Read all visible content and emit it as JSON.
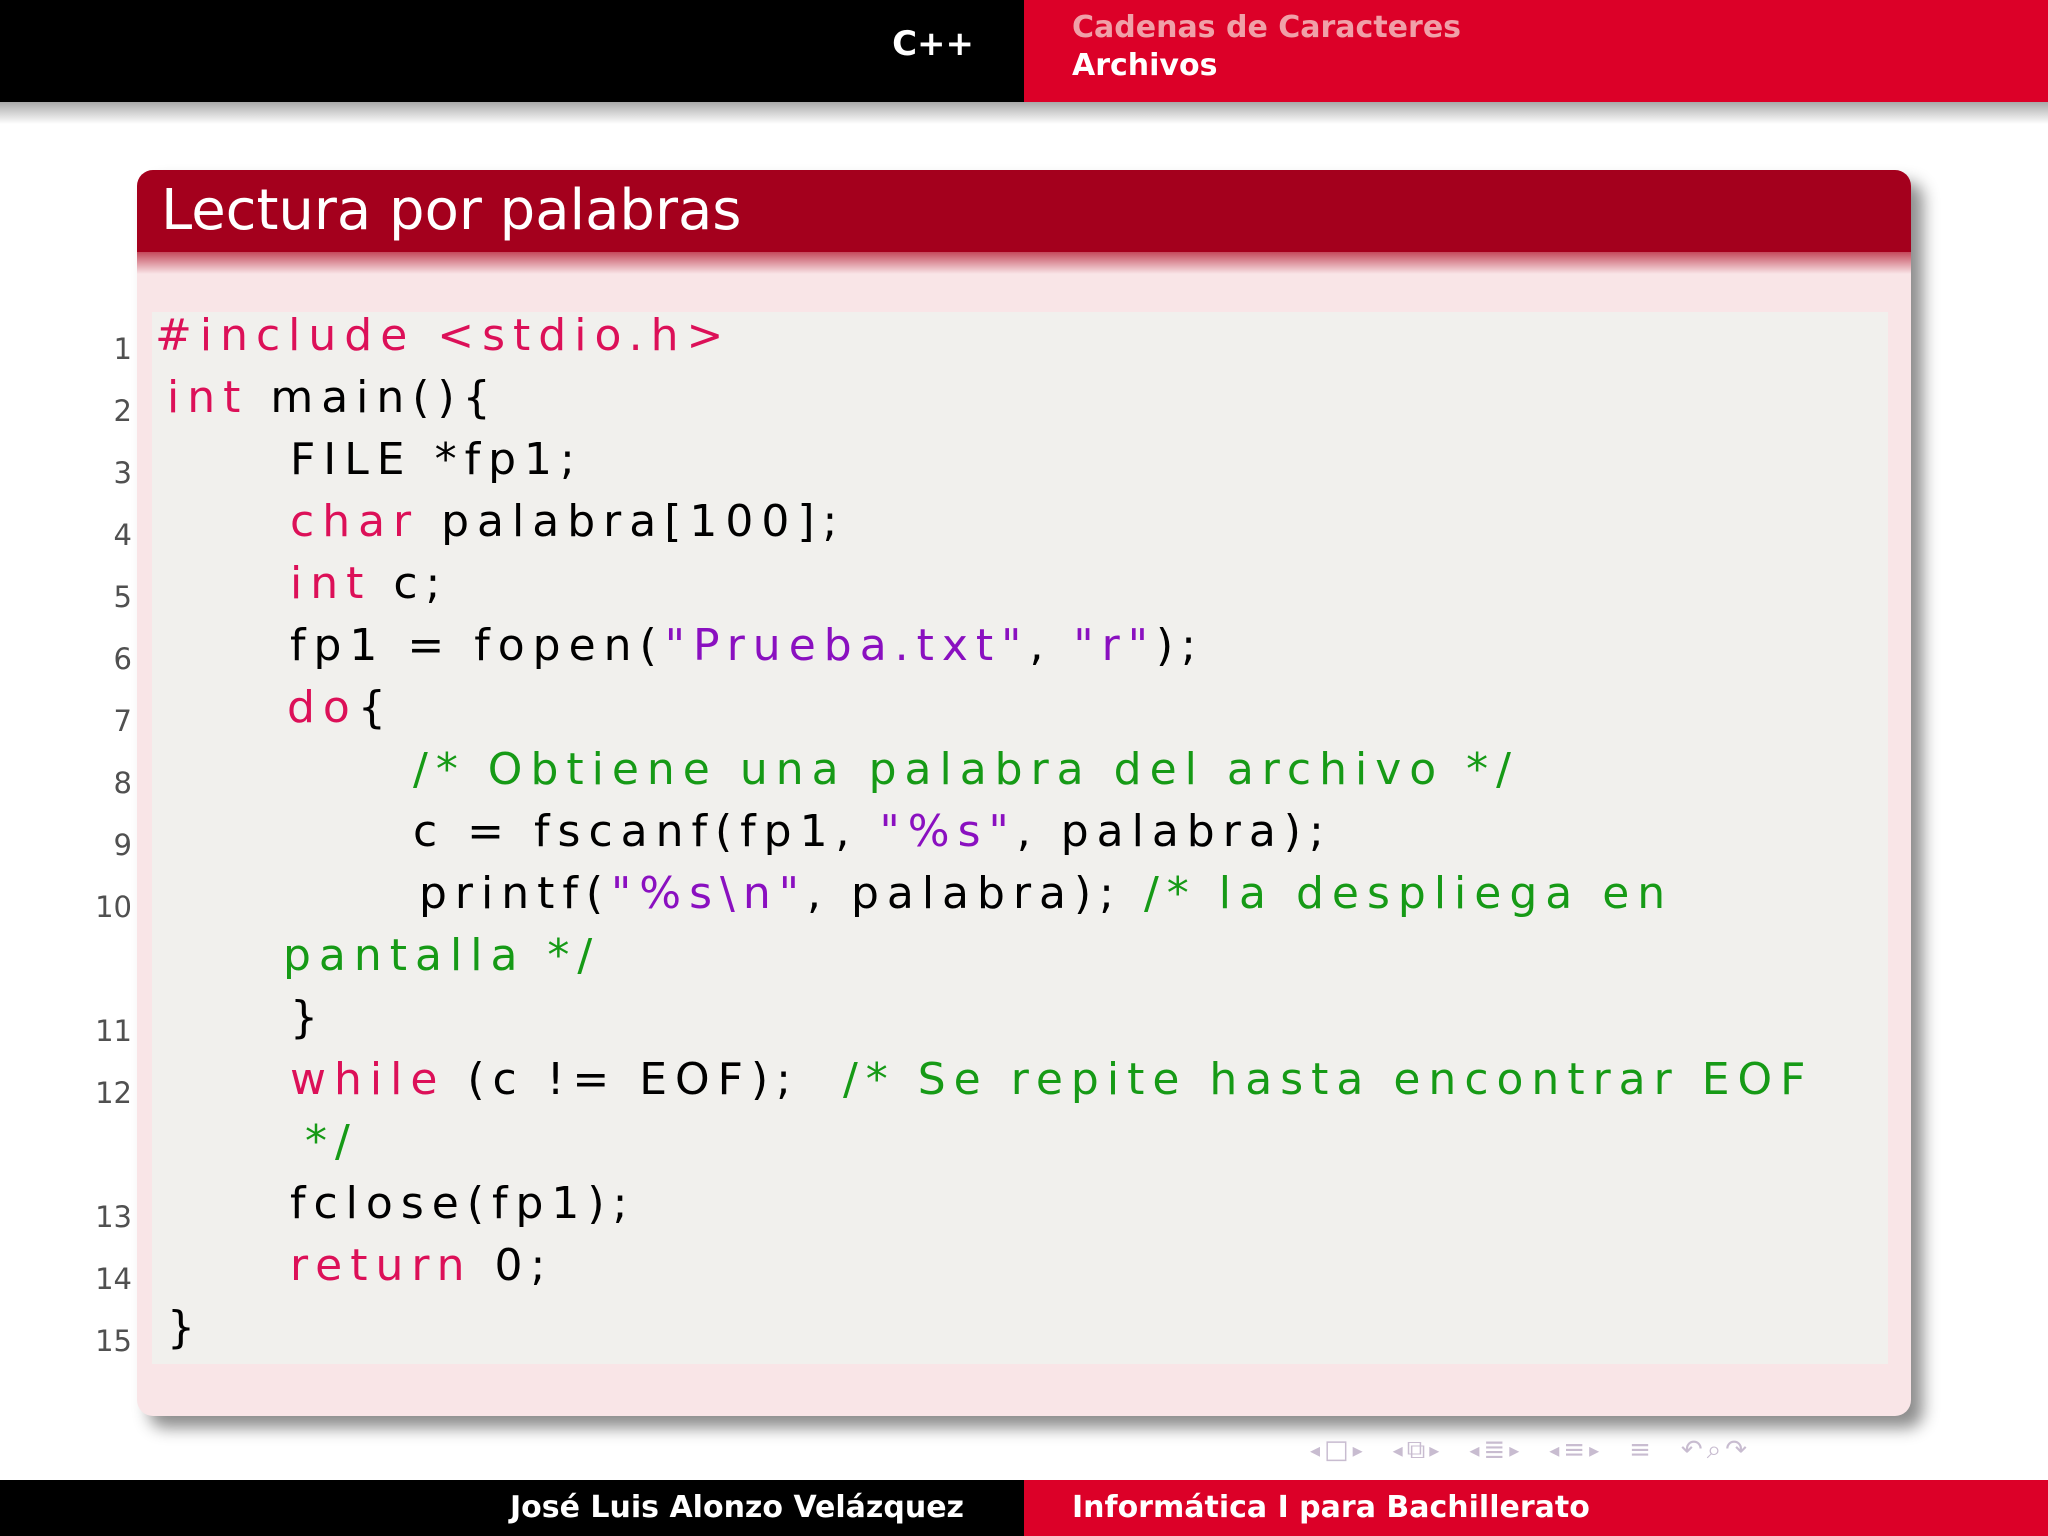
{
  "header": {
    "title": "C++",
    "section_prev": "Cadenas de Caracteres",
    "section_current": "Archivos"
  },
  "block": {
    "title": "Lectura por palabras"
  },
  "code": {
    "line_numbers": [
      "1",
      "2",
      "3",
      "4",
      "5",
      "6",
      "7",
      "8",
      "9",
      "10",
      "11",
      "12",
      "13",
      "14",
      "15"
    ],
    "l1": "#include <stdio.h>",
    "l2_kw": "int",
    "l2_rest": " main(){",
    "l3": "FILE *fp1;",
    "l4_kw": "char",
    "l4_rest": " palabra[100];",
    "l5_kw": "int",
    "l5_rest": " c;",
    "l6_a": "fp1 = fopen(",
    "l6_s1": "\"Prueba.txt\"",
    "l6_b": ", ",
    "l6_s2": "\"r\"",
    "l6_c": ");",
    "l7_kw": "do",
    "l7_rest": "{",
    "l8": "/* Obtiene una palabra del archivo */",
    "l9_a": "c = fscanf(fp1, ",
    "l9_s": "\"%s\"",
    "l9_b": ", palabra);",
    "l10_a": "printf(",
    "l10_s": "\"%s\\n\"",
    "l10_b": ", palabra); ",
    "l10_c": "/* la despliega en",
    "l10_cont": "pantalla */",
    "l11": "}",
    "l12_kw": "while",
    "l12_a": " (c != EOF);  ",
    "l12_c": "/* Se repite hasta encontrar EOF",
    "l12_cont": "*/",
    "l13": "fclose(fp1);",
    "l14_kw": "return",
    "l14_rest": " 0;",
    "l15": "}"
  },
  "footer": {
    "author": "José Luis Alonzo Velázquez",
    "course": "Informática I para Bachillerato"
  },
  "colors": {
    "accent_red": "#dc0028",
    "block_title_bg": "#a4001d",
    "keyword": "#dc1058",
    "string": "#8a10c0",
    "comment": "#169a16"
  }
}
